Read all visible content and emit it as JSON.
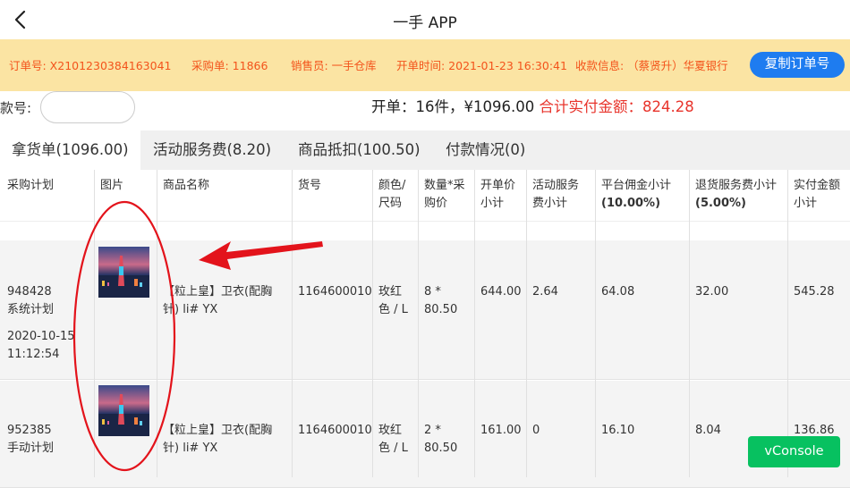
{
  "header": {
    "title": "一手 APP",
    "back_icon": "chevron-left-icon"
  },
  "order_info": {
    "order_no": "订单号: X2101230384163041",
    "purchase_no": "采购单: 11866",
    "salesperson": "销售员: 一手仓库",
    "open_time": "开单时间: 2021-01-23 16:30:41",
    "payee": "收款信息: （蔡贤升）华夏银行",
    "copy_button": "复制订单号"
  },
  "search": {
    "label": "款号:",
    "value": ""
  },
  "summary": {
    "text": "开单：16件，¥1096.00 ",
    "highlight": "合计实付金额：824.28"
  },
  "tabs": [
    {
      "label": "拿货单(1096.00)"
    },
    {
      "label": "活动服务费(8.20)"
    },
    {
      "label": "商品抵扣(100.50)"
    },
    {
      "label": "付款情况(0)"
    }
  ],
  "table": {
    "headers": [
      {
        "l1": "采购计划",
        "l2": ""
      },
      {
        "l1": "图片",
        "l2": ""
      },
      {
        "l1": "商品名称",
        "l2": ""
      },
      {
        "l1": "货号",
        "l2": ""
      },
      {
        "l1": "颜色/",
        "l2": "尺码"
      },
      {
        "l1": "数量*采",
        "l2": "购价"
      },
      {
        "l1": "开单价",
        "l2": "小计"
      },
      {
        "l1": "活动服务",
        "l2": "费小计"
      },
      {
        "l1": "平台佣金小计",
        "l2": "(10.00%)"
      },
      {
        "l1": "退货服务费小计",
        "l2": "(5.00%)"
      },
      {
        "l1": "实付金额",
        "l2": "小计"
      }
    ],
    "rows": [
      {
        "plan_id": "948428",
        "plan_type": "系统计划",
        "plan_date": "2020-10-15",
        "plan_time": "11:12:54",
        "name_l1": "【粒上皇】卫衣(配胸",
        "name_l2": "针) li# YX",
        "sku": "1164600010",
        "color_l1": "玫红",
        "color_l2": "色 / L",
        "qty_l1": "8 *",
        "qty_l2": "80.50",
        "open_subtotal": "644.00",
        "activity_fee": "2.64",
        "commission": "64.08",
        "return_fee": "32.00",
        "paid_subtotal": "545.28"
      },
      {
        "plan_id": "952385",
        "plan_type": "手动计划",
        "plan_date": "",
        "plan_time": "",
        "name_l1": "【粒上皇】卫衣(配胸",
        "name_l2": "针) li# YX",
        "sku": "1164600010",
        "color_l1": "玫红",
        "color_l2": "色 / L",
        "qty_l1": "2 *",
        "qty_l2": "80.50",
        "open_subtotal": "161.00",
        "activity_fee": "0",
        "commission": "16.10",
        "return_fee": "8.04",
        "paid_subtotal": "136.86"
      }
    ]
  },
  "vconsole": {
    "label": "vConsole"
  },
  "colors": {
    "accent_orange": "#f3531b",
    "banner_bg": "#fbe4a3",
    "button_blue": "#1e7cf0",
    "highlight_red": "#e8342c",
    "vconsole_green": "#07c160"
  }
}
